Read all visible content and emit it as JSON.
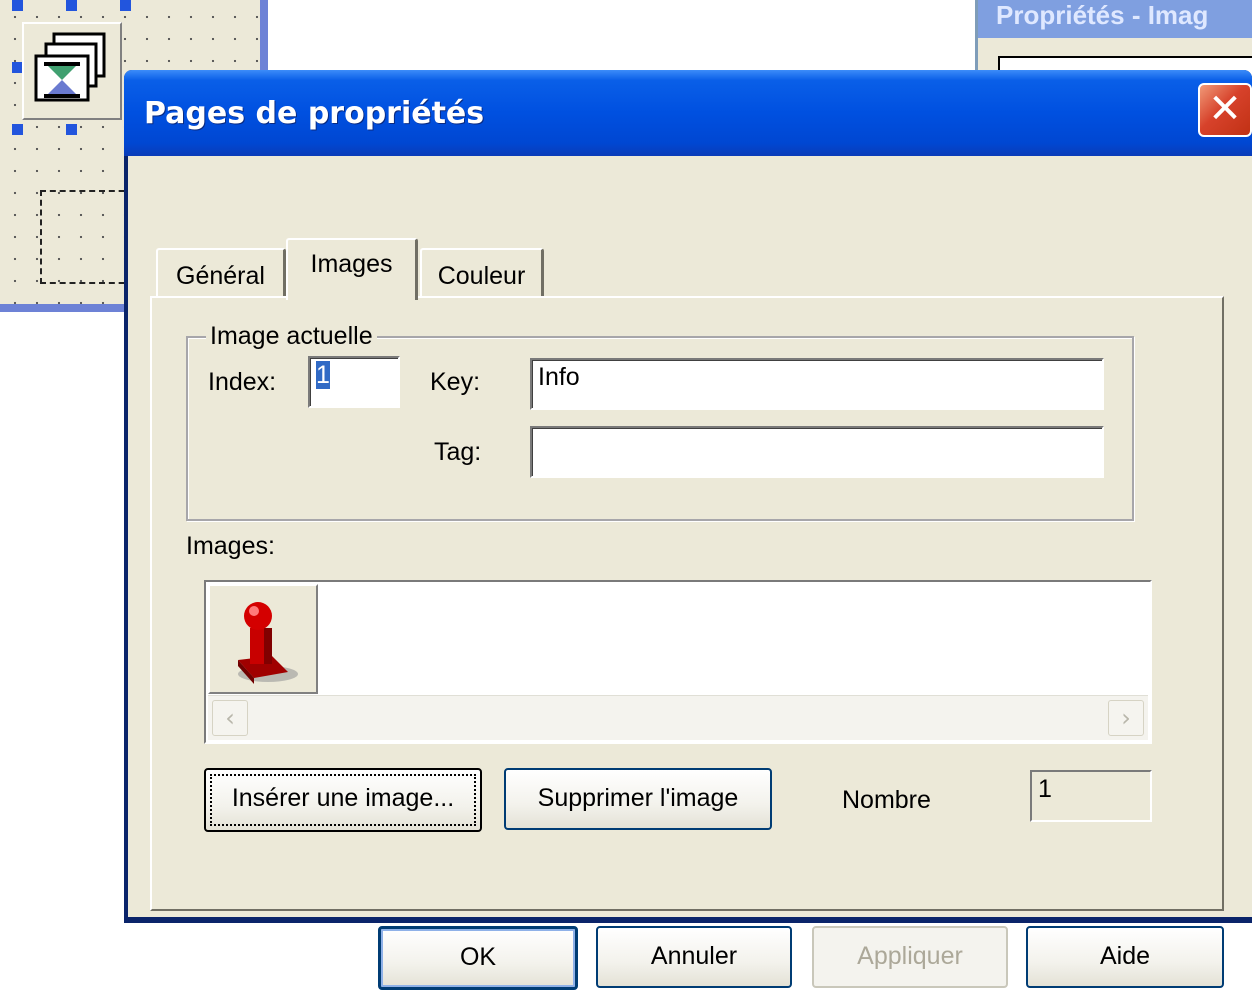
{
  "background": {
    "props_window_title": "Propriétés - Imag"
  },
  "dialog": {
    "title": "Pages de propriétés",
    "close_glyph": "✕",
    "tabs": [
      {
        "label": "Général",
        "active": false
      },
      {
        "label": "Images",
        "active": true
      },
      {
        "label": "Couleur",
        "active": false
      }
    ]
  },
  "current_image": {
    "group_label": "Image actuelle",
    "index_label": "Index:",
    "index_value": "1",
    "key_label": "Key:",
    "key_value": "Info",
    "tag_label": "Tag:",
    "tag_value": ""
  },
  "images": {
    "label": "Images:",
    "thumbnails": [
      "red-pawn-icon"
    ]
  },
  "actions": {
    "insert_label": "Insérer une image...",
    "delete_label": "Supprimer l'image",
    "count_label": "Nombre",
    "count_value": "1"
  },
  "footer": {
    "ok": "OK",
    "cancel": "Annuler",
    "apply": "Appliquer",
    "help": "Aide"
  },
  "colors": {
    "title_blue": "#0050e0",
    "face": "#ece9d8",
    "close_red": "#d7422b",
    "selection": "#316ac5"
  }
}
